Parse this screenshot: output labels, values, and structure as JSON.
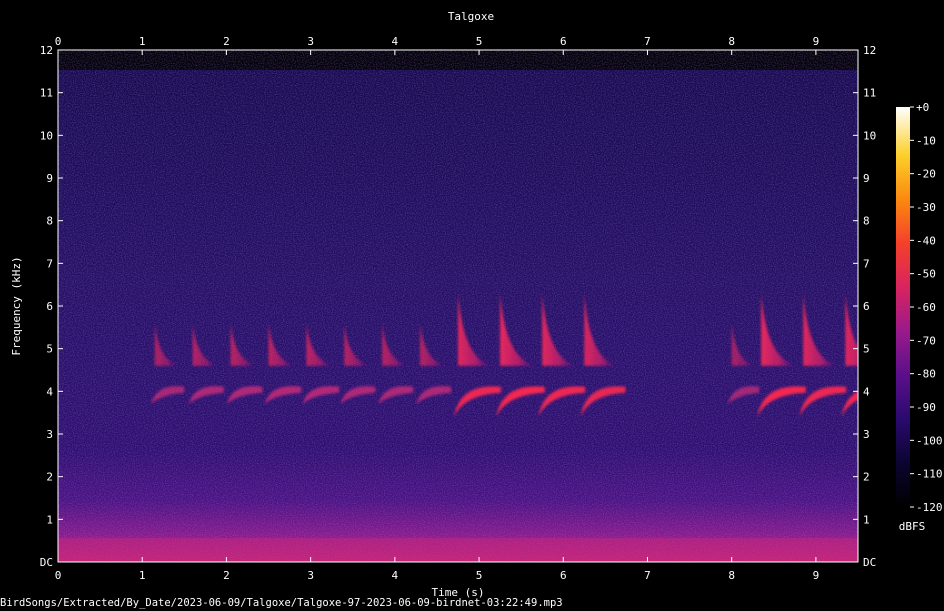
{
  "chart_data": {
    "type": "heatmap",
    "title": "Talgoxe",
    "xlabel": "Time (s)",
    "ylabel": "Frequency (kHz)",
    "xlim": [
      0,
      9.5
    ],
    "ylim": [
      0,
      12
    ],
    "x_ticks": [
      0,
      1,
      2,
      3,
      4,
      5,
      6,
      7,
      8,
      9
    ],
    "y_ticks": [
      "DC",
      "1",
      "2",
      "3",
      "4",
      "5",
      "6",
      "7",
      "8",
      "9",
      "10",
      "11",
      "12"
    ],
    "colorbar": {
      "label": "dBFS",
      "range": [
        -120,
        0
      ],
      "ticks": [
        "+0",
        "-10",
        "-20",
        "-30",
        "-40",
        "-50",
        "-60",
        "-70",
        "-80",
        "-90",
        "-100",
        "-110",
        "-120"
      ],
      "colors": [
        "#000000",
        "#0b0530",
        "#2a0a6e",
        "#5b0f8a",
        "#9a1a8a",
        "#d8245e",
        "#f5402a",
        "#fb8a10",
        "#fcd02a",
        "#ffffff"
      ]
    },
    "noise_floor_khz": 11.5,
    "call_bands_khz": {
      "low": [
        3.7,
        4.2
      ],
      "high": [
        4.6,
        5.6
      ]
    },
    "calls_time_s": [
      1.15,
      1.6,
      2.05,
      2.5,
      2.95,
      3.4,
      3.85,
      4.3,
      4.75,
      5.25,
      5.75,
      6.25,
      8.0,
      8.35,
      8.85,
      9.35
    ],
    "calls_intensity": [
      0.45,
      0.5,
      0.52,
      0.55,
      0.55,
      0.5,
      0.5,
      0.5,
      0.85,
      0.9,
      0.85,
      0.8,
      0.4,
      0.9,
      0.85,
      0.85
    ]
  },
  "caption": "BirdSongs/Extracted/By_Date/2023-06-09/Talgoxe/Talgoxe-97-2023-06-09-birdnet-03:22:49.mp3"
}
